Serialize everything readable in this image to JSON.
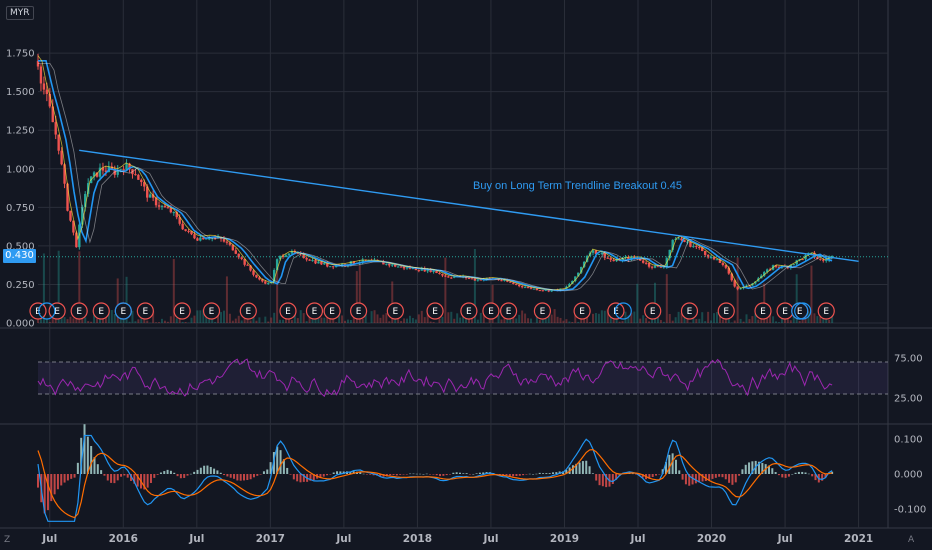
{
  "currency": "MYR",
  "last_price_label": "0.430",
  "last_price": 0.43,
  "annotation": "Buy on Long Term Trendline Breakout 0.45",
  "corner_left": "Z",
  "corner_right": "A",
  "colors": {
    "background": "#131722",
    "grid": "#2a2e39",
    "trendline": "#2f9bf2",
    "rsi": "#9c27b0",
    "macd": "#2196f3",
    "signal": "#ff6d00",
    "up": "#26a69a",
    "down": "#ef5350",
    "price_tag": "#2f9bf2"
  },
  "chart_data": [
    {
      "type": "line",
      "panel": "price",
      "yticks": [
        "1.750",
        "1.500",
        "1.250",
        "1.000",
        "0.750",
        "0.500",
        "0.250",
        "0.000"
      ],
      "ytick_values": [
        1.75,
        1.5,
        1.25,
        1.0,
        0.75,
        0.5,
        0.25,
        0.0
      ],
      "ylim": [
        0.0,
        1.9
      ],
      "xlim": [
        2015.42,
        2021.2
      ],
      "xticks": [
        "Jul",
        "2016",
        "Jul",
        "2017",
        "Jul",
        "2018",
        "Jul",
        "2019",
        "Jul",
        "2020",
        "Jul",
        "2021"
      ],
      "xtick_values": [
        2015.5,
        2016.0,
        2016.5,
        2017.0,
        2017.5,
        2018.0,
        2018.5,
        2019.0,
        2019.5,
        2020.0,
        2020.5,
        2021.0
      ],
      "series": [
        {
          "x": [
            2015.42,
            2015.45,
            2015.5,
            2015.56,
            2015.62,
            2015.68,
            2015.75,
            2015.85,
            2015.95,
            2016.0,
            2016.08,
            2016.17,
            2016.25,
            2016.33,
            2016.42,
            2016.5,
            2016.58,
            2016.67,
            2016.75,
            2016.83,
            2016.92,
            2017.0,
            2017.05,
            2017.12,
            2017.2,
            2017.3,
            2017.4,
            2017.5,
            2017.6,
            2017.7,
            2017.8,
            2017.9,
            2018.0,
            2018.1,
            2018.2,
            2018.3,
            2018.4,
            2018.5,
            2018.6,
            2018.7,
            2018.8,
            2018.9,
            2019.0,
            2019.08,
            2019.17,
            2019.25,
            2019.33,
            2019.42,
            2019.5,
            2019.58,
            2019.67,
            2019.75,
            2019.83,
            2019.92,
            2020.0,
            2020.08,
            2020.17,
            2020.25,
            2020.33,
            2020.42,
            2020.5,
            2020.58,
            2020.67,
            2020.75,
            2020.82
          ],
          "values": [
            1.7,
            1.55,
            1.38,
            1.15,
            0.75,
            0.5,
            0.9,
            1.0,
            0.98,
            1.02,
            0.98,
            0.82,
            0.76,
            0.72,
            0.6,
            0.55,
            0.56,
            0.54,
            0.48,
            0.38,
            0.28,
            0.25,
            0.42,
            0.46,
            0.44,
            0.4,
            0.37,
            0.38,
            0.4,
            0.4,
            0.38,
            0.36,
            0.35,
            0.34,
            0.3,
            0.3,
            0.28,
            0.29,
            0.27,
            0.24,
            0.22,
            0.21,
            0.22,
            0.3,
            0.47,
            0.45,
            0.4,
            0.42,
            0.42,
            0.37,
            0.36,
            0.56,
            0.52,
            0.48,
            0.42,
            0.38,
            0.22,
            0.24,
            0.3,
            0.37,
            0.36,
            0.4,
            0.45,
            0.4,
            0.43
          ]
        }
      ],
      "trendline": {
        "x": [
          2015.7,
          2021.0
        ],
        "values": [
          1.12,
          0.4
        ]
      },
      "earnings_dates": [
        2015.42,
        2015.55,
        2015.7,
        2015.85,
        2016.0,
        2016.15,
        2016.4,
        2016.6,
        2016.85,
        2017.12,
        2017.3,
        2017.42,
        2017.6,
        2017.85,
        2018.12,
        2018.35,
        2018.5,
        2018.62,
        2018.85,
        2019.12,
        2019.35,
        2019.6,
        2019.85,
        2020.1,
        2020.35,
        2020.5,
        2020.6,
        2020.78
      ],
      "dividend_dates": [
        2015.48,
        2016.0,
        2019.4,
        2020.6,
        2020.62
      ]
    },
    {
      "type": "line",
      "panel": "rsi",
      "yticks": [
        "75.00",
        "25.00"
      ],
      "ytick_values": [
        75,
        25
      ],
      "ylim": [
        0,
        100
      ],
      "bands": [
        70,
        30
      ]
    },
    {
      "type": "line",
      "panel": "macd",
      "yticks": [
        "0.100",
        "0.000",
        "-0.100"
      ],
      "ytick_values": [
        0.1,
        0.0,
        -0.1
      ],
      "ylim": [
        -0.14,
        0.12
      ]
    }
  ]
}
